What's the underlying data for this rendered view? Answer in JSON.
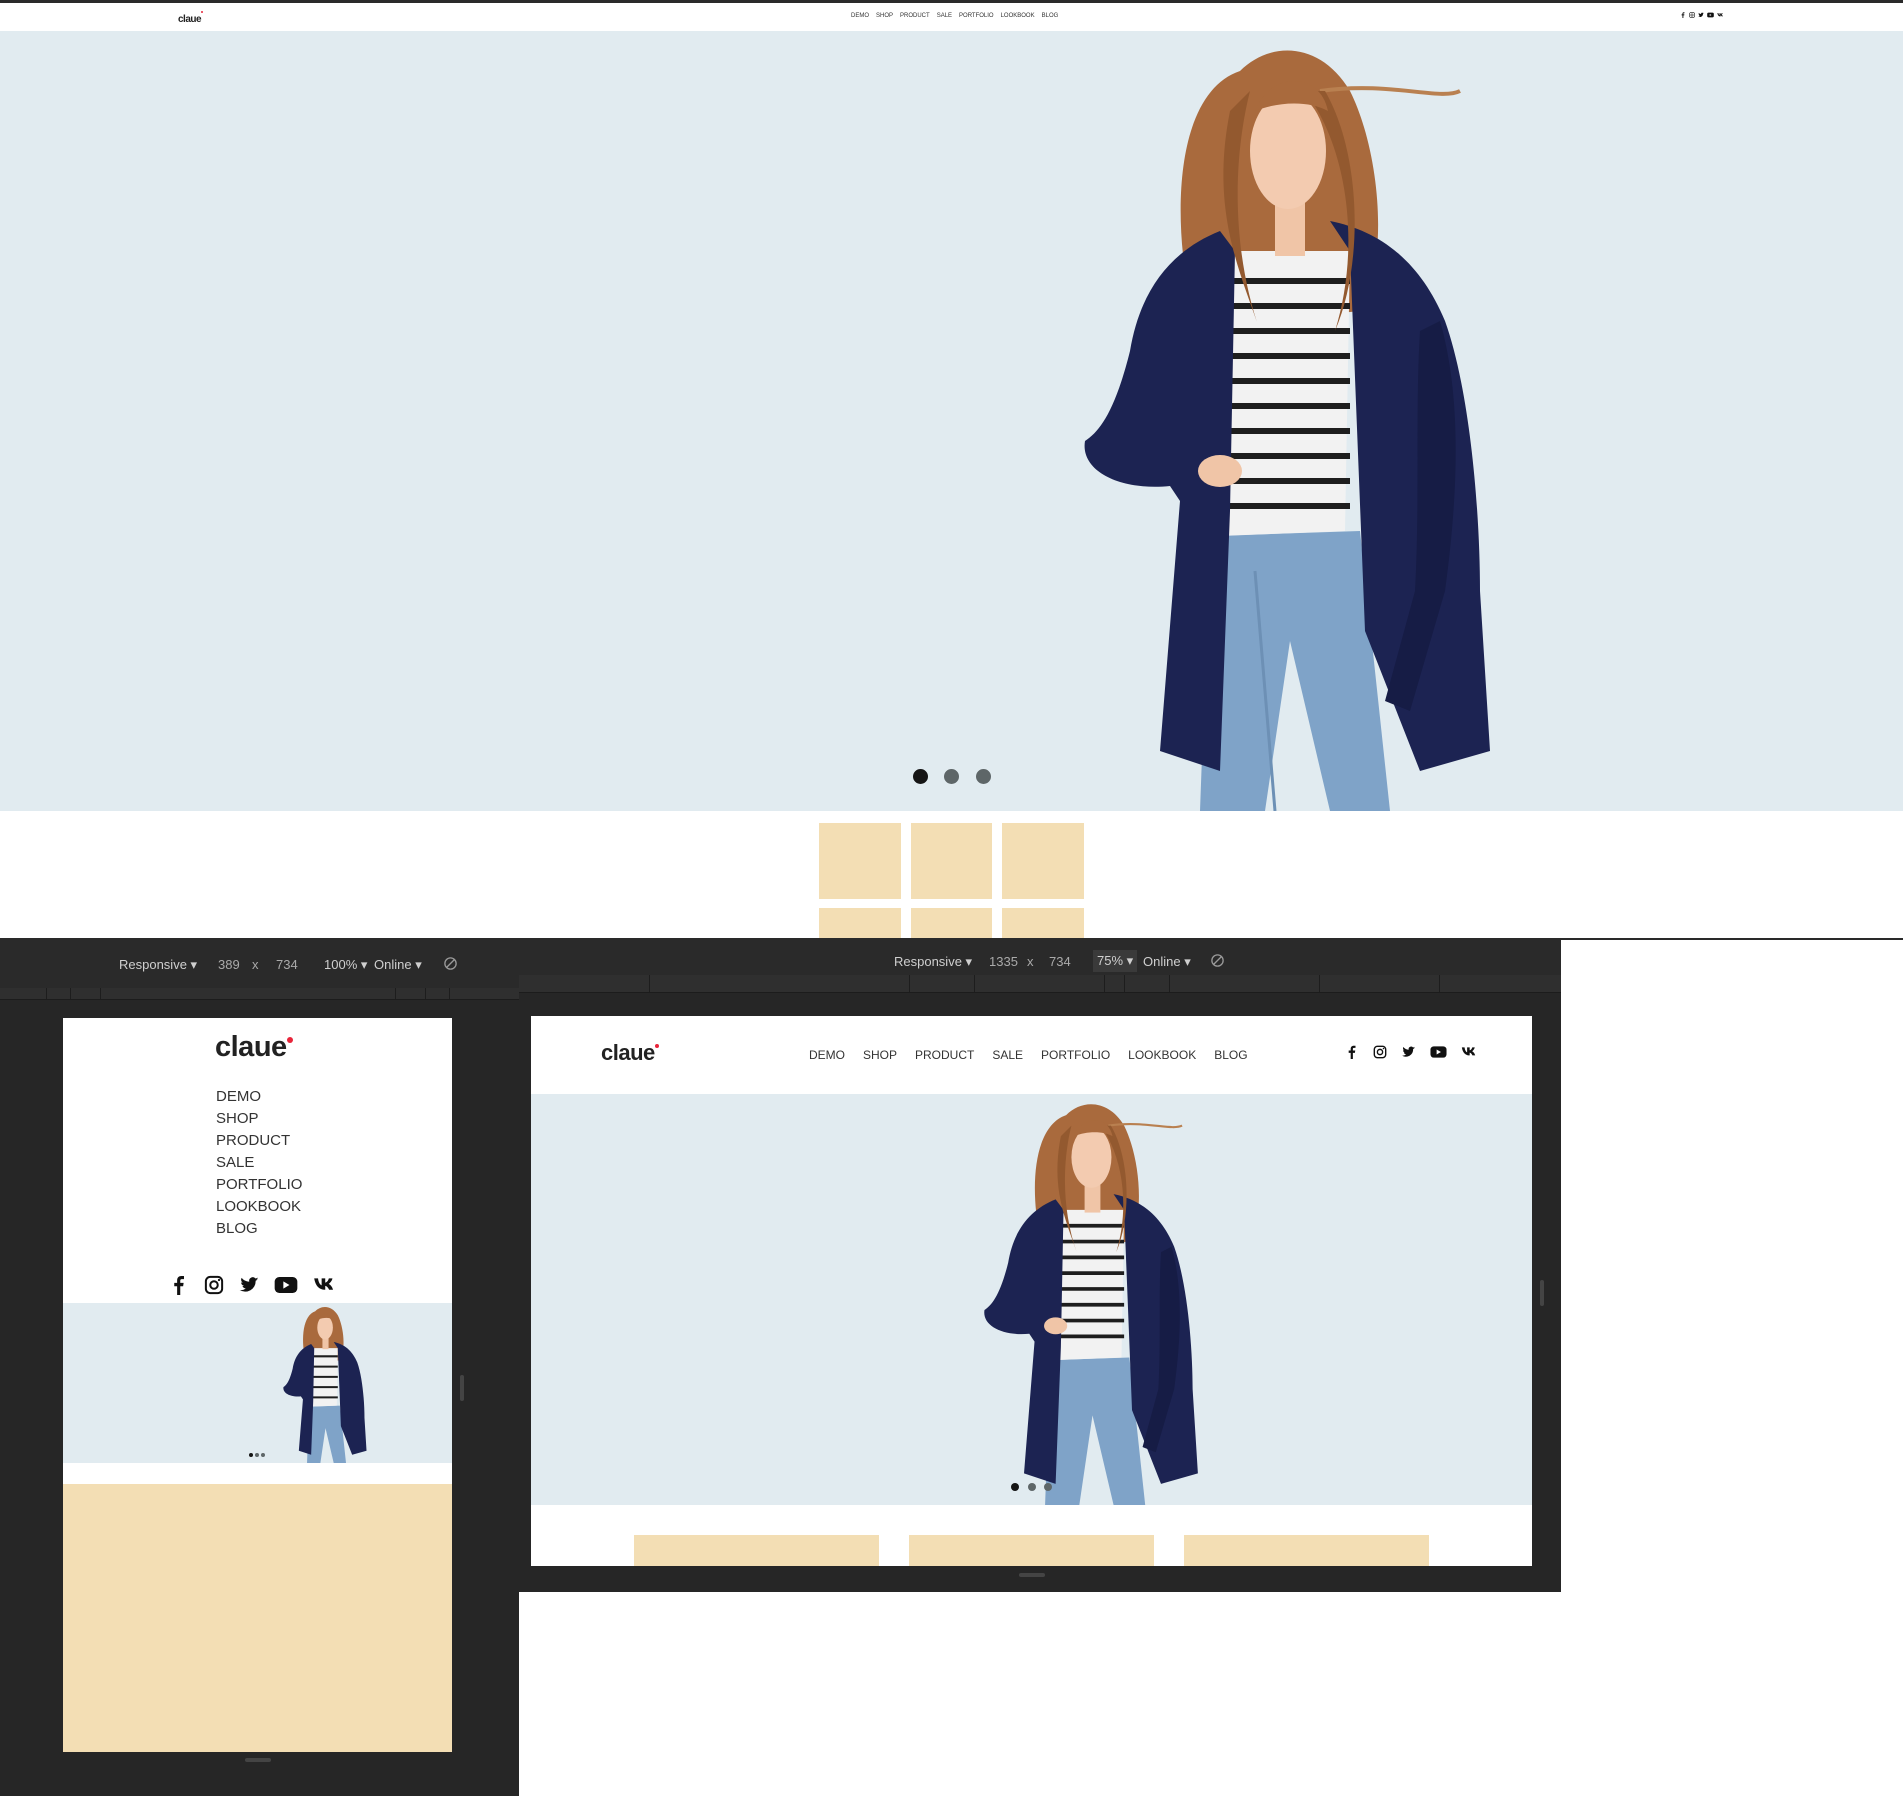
{
  "brand": {
    "logo": "claue"
  },
  "nav": [
    "DEMO",
    "SHOP",
    "PRODUCT",
    "SALE",
    "PORTFOLIO",
    "LOOKBOOK",
    "BLOG"
  ],
  "social": [
    "facebook-icon",
    "instagram-icon",
    "twitter-icon",
    "youtube-icon",
    "vk-icon"
  ],
  "colors": {
    "hero_bg": "#e1ebf0",
    "tile": "#f3deb4",
    "cardigan": "#1c2352",
    "denim": "#7fa3c8",
    "hair": "#a96a3d",
    "devtools": "#2a2a2a",
    "accent_dot": "#e8253a"
  },
  "slider": {
    "slides": 3,
    "active": 1
  },
  "devices": {
    "mobile": {
      "mode": "Responsive",
      "width": "389",
      "times": "x",
      "height": "734",
      "zoom": "100%",
      "network": "Online"
    },
    "tablet": {
      "mode": "Responsive",
      "width": "1335",
      "times": "x",
      "height": "734",
      "zoom": "75%",
      "network": "Online"
    }
  }
}
